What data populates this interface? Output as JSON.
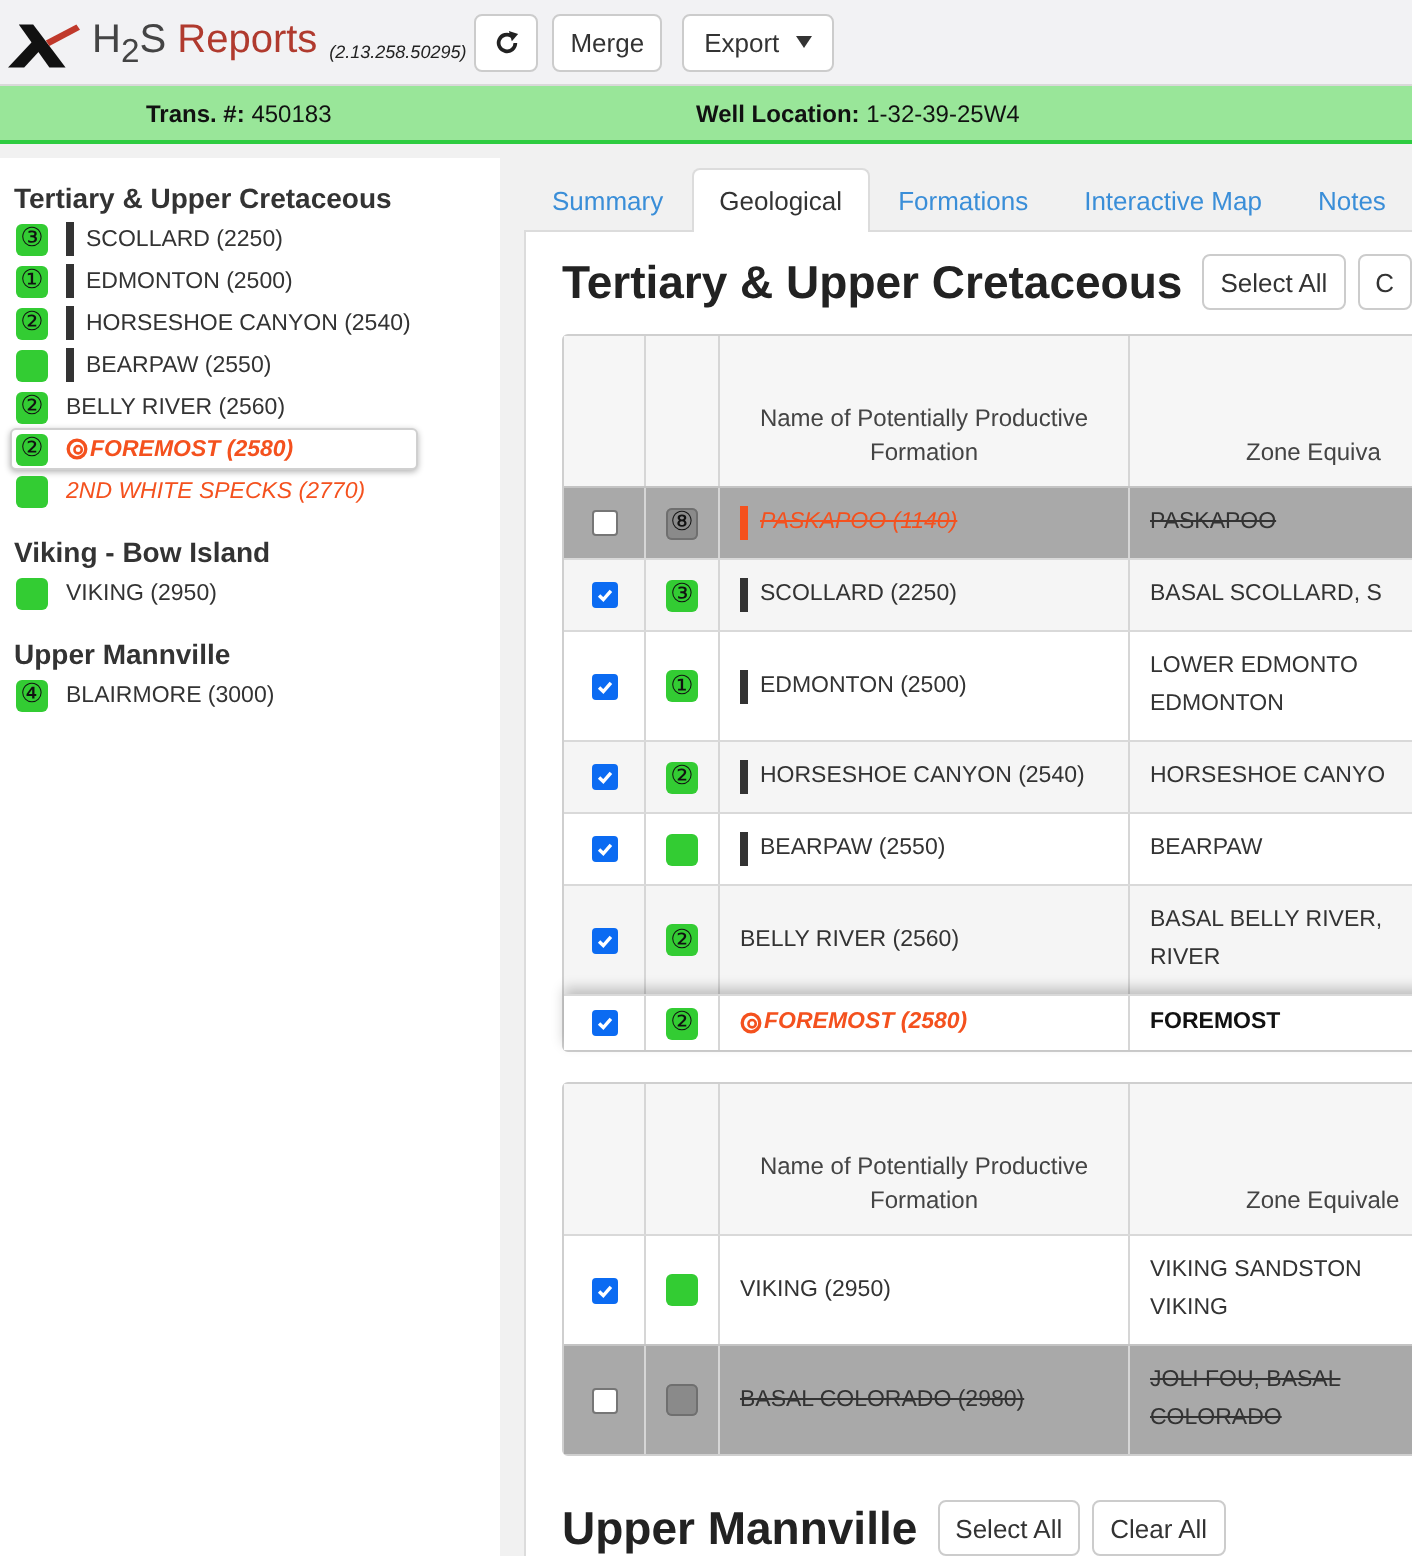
{
  "header": {
    "brand": {
      "name": "H$_{2}$S",
      "product": "Reports",
      "version": "(2.13.258.50295)"
    },
    "buttons": [
      {
        "kind": "refresh"
      },
      {
        "kind": "action",
        "label": "Merge"
      },
      {
        "kind": "menu",
        "label": "Export"
      }
    ]
  },
  "info_bar": [
    "**Trans. #:** 450183",
    "**Well Location:** 1-32-39-25W4"
  ],
  "sidebar": {
    "groups": [
      {
        "title": "Tertiary & Upper Cretaceous",
        "items": [
          {
            "name": "SCOLLARD (2250)",
            "badge": "③",
            "marker": true,
            "kind": "normal",
            "selected": false
          },
          {
            "name": "EDMONTON (2500)",
            "badge": "①",
            "marker": true,
            "kind": "normal",
            "selected": false
          },
          {
            "name": "HORSESHOE CANYON (2540)",
            "badge": "②",
            "marker": true,
            "kind": "normal",
            "selected": false
          },
          {
            "name": "BEARPAW (2550)",
            "marker": true,
            "kind": "normal",
            "selected": false
          },
          {
            "name": "BELLY RIVER (2560)",
            "badge": "②",
            "marker": false,
            "kind": "normal",
            "selected": false
          },
          {
            "name": "FOREMOST (2580)",
            "badge": "②",
            "marker": false,
            "kind": "primary",
            "selected": true
          },
          {
            "name": "2ND WHITE SPECKS (2770)",
            "marker": false,
            "kind": "flagged",
            "selected": false
          }
        ]
      },
      {
        "title": "Viking - Bow Island",
        "items": [
          {
            "name": "VIKING (2950)",
            "marker": false,
            "kind": "normal",
            "selected": false
          }
        ]
      },
      {
        "title": "Upper Mannville",
        "items": [
          {
            "name": "BLAIRMORE (3000)",
            "badge": "④",
            "marker": false,
            "kind": "normal",
            "selected": false
          }
        ]
      }
    ]
  },
  "tabs": [
    {
      "label": "Summary",
      "selected": false
    },
    {
      "label": "Geological",
      "selected": true
    },
    {
      "label": "Formations",
      "selected": false
    },
    {
      "label": "Interactive Map",
      "selected": false
    },
    {
      "label": "Notes",
      "selected": false
    }
  ],
  "sections": [
    {
      "title": "Tertiary & Upper Cretaceous",
      "buttons": [
        "Select All",
        "C"
      ],
      "table": {
        "columns": [
          "Name of Potentially Productive Formation",
          "Zone Equiva"
        ],
        "rows": [
          {
            "checked": false,
            "badge": "⑧",
            "marker": true,
            "kind": "flagged",
            "name": "PASKAPOO (1140)",
            "zone": "PASKAPOO",
            "selected": false
          },
          {
            "checked": true,
            "badge": "③",
            "marker": true,
            "kind": "normal",
            "name": "SCOLLARD (2250)",
            "zone": "BASAL SCOLLARD, S",
            "selected": false
          },
          {
            "checked": true,
            "badge": "①",
            "marker": true,
            "kind": "normal",
            "name": "EDMONTON (2500)",
            "zone": "LOWER EDMONTO\nEDMONTON",
            "selected": false
          },
          {
            "checked": true,
            "badge": "②",
            "marker": true,
            "kind": "normal",
            "name": "HORSESHOE CANYON (2540)",
            "zone": "HORSESHOE CANYO",
            "selected": false
          },
          {
            "checked": true,
            "marker": true,
            "kind": "normal",
            "name": "BEARPAW (2550)",
            "zone": "BEARPAW",
            "selected": false
          },
          {
            "checked": true,
            "badge": "②",
            "marker": false,
            "kind": "normal",
            "name": "BELLY RIVER (2560)",
            "zone": "BASAL BELLY RIVER,\nRIVER",
            "selected": false
          },
          {
            "checked": true,
            "badge": "②",
            "marker": false,
            "kind": "primary",
            "name": "FOREMOST (2580)",
            "zone": "FOREMOST",
            "selected": true
          }
        ]
      }
    },
    {
      "table": {
        "columns": [
          "Name of Potentially Productive Formation",
          "Zone Equivale"
        ],
        "rows": [
          {
            "checked": true,
            "marker": false,
            "kind": "normal",
            "name": "VIKING (2950)",
            "zone": "VIKING SANDSTON\nVIKING",
            "selected": false
          },
          {
            "checked": false,
            "marker": false,
            "kind": "normal",
            "name": "BASAL COLORADO (2980)",
            "zone": "JOLI FOU, BASAL\nCOLORADO",
            "selected": false
          }
        ]
      }
    },
    {
      "title": "Upper Mannville",
      "buttons": [
        "Select All",
        "Clear All"
      ]
    }
  ]
}
